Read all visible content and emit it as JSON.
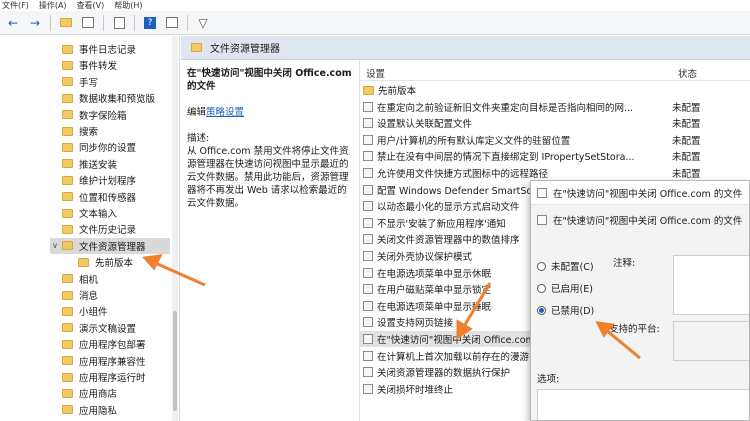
{
  "menu": [
    "文件(F)",
    "操作(A)",
    "查看(V)",
    "帮助(H)"
  ],
  "toolbar_icons": [
    "back-arrow-icon",
    "forward-arrow-icon",
    "up-folder-icon",
    "show-tree-icon",
    "export-icon",
    "help-icon",
    "properties-icon",
    "filter-icon"
  ],
  "tree": {
    "items": [
      {
        "label": "事件日志记录"
      },
      {
        "label": "事件转发"
      },
      {
        "label": "手写"
      },
      {
        "label": "数据收集和预览版"
      },
      {
        "label": "数字保险箱"
      },
      {
        "label": "搜索"
      },
      {
        "label": "同步你的设置"
      },
      {
        "label": "推送安装"
      },
      {
        "label": "维护计划程序"
      },
      {
        "label": "位置和传感器"
      },
      {
        "label": "文本输入"
      },
      {
        "label": "文件历史记录"
      },
      {
        "label": "文件资源管理器"
      },
      {
        "label": "先前版本"
      },
      {
        "label": "相机"
      },
      {
        "label": "消息"
      },
      {
        "label": "小组件"
      },
      {
        "label": "演示文稿设置"
      },
      {
        "label": "应用程序包部署"
      },
      {
        "label": "应用程序兼容性"
      },
      {
        "label": "应用程序运行时"
      },
      {
        "label": "应用商店"
      },
      {
        "label": "应用隐私"
      }
    ]
  },
  "panel": {
    "header": "文件资源管理器"
  },
  "description": {
    "title": "在\"快速访问\"视图中关闭 Office.com 的文件",
    "edit_prefix": "编辑",
    "edit_link": "策略设置",
    "desc_label": "描述:",
    "desc_text": "从 Office.com 禁用文件将停止文件资源管理器在快速访问视图中显示最近的云文件数据。禁用此功能后，资源管理器将不再发出 Web 请求以检索最近的云文件数据。"
  },
  "list": {
    "col_setting": "设置",
    "col_state": "状态",
    "rows": [
      {
        "text": "先前版本",
        "state": ""
      },
      {
        "text": "在重定向之前验证新旧文件夹重定向目标是否指向相同的网...",
        "state": "未配置"
      },
      {
        "text": "设置默认关联配置文件",
        "state": "未配置"
      },
      {
        "text": "用户/计算机的所有默认库定义文件的驻留位置",
        "state": "未配置"
      },
      {
        "text": "禁止在没有中间层的情况下直接绑定到 IPropertySetStora...",
        "state": "未配置"
      },
      {
        "text": "允许使用文件快捷方式图标中的远程路径",
        "state": "未配置"
      },
      {
        "text": "配置 Windows Defender SmartScreen",
        "state": ""
      },
      {
        "text": "以动态最小化的显示方式启动文件",
        "state": ""
      },
      {
        "text": "不显示'安装了新应用程序'通知",
        "state": ""
      },
      {
        "text": "关闭文件资源管理器中的数值排序",
        "state": ""
      },
      {
        "text": "关闭外壳协议保护模式",
        "state": ""
      },
      {
        "text": "在电源选项菜单中显示休眠",
        "state": ""
      },
      {
        "text": "在用户磁贴菜单中显示锁定",
        "state": ""
      },
      {
        "text": "在电源选项菜单中显示睡眠",
        "state": ""
      },
      {
        "text": "设置支持网页链接",
        "state": ""
      },
      {
        "text": "在\"快速访问\"视图中关闭 Office.com",
        "state": ""
      },
      {
        "text": "在计算机上首次加载以前存在的漫游",
        "state": ""
      },
      {
        "text": "关闭资源管理器的数据执行保护",
        "state": ""
      },
      {
        "text": "关闭损坏时堆终止",
        "state": ""
      }
    ]
  },
  "dialog": {
    "title": "在\"快速访问\"视图中关闭 Office.com 的文件",
    "subtitle": "在\"快速访问\"视图中关闭 Office.com 的文件",
    "options": [
      {
        "label": "未配置(C)",
        "checked": false
      },
      {
        "label": "已启用(E)",
        "checked": false
      },
      {
        "label": "已禁用(D)",
        "checked": true
      }
    ],
    "comment_label": "注释:",
    "platform_label": "支持的平台:",
    "options_label": "选项:"
  },
  "colors": {
    "accent": "#1f5fbf",
    "arrow": "#f07f2e",
    "folder": "#f3c964"
  }
}
